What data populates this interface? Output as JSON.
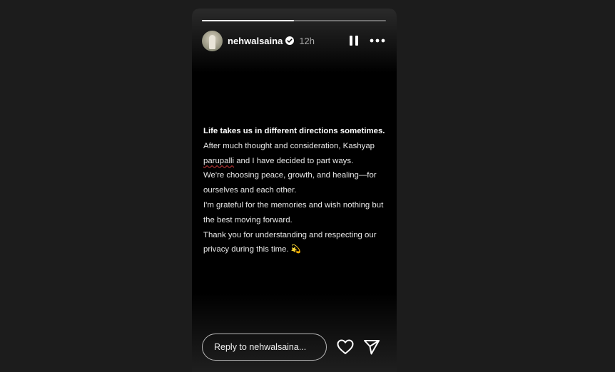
{
  "story": {
    "progress_fraction": 0.5,
    "user": {
      "username": "nehwalsaina",
      "verified": true,
      "time_ago": "12h"
    },
    "caption": {
      "lead": "Life takes us in different directions sometimes.",
      "line_a": "After much thought and consideration, Kashyap",
      "name_word": "parupalli",
      "line_b": " and I have decided to part ways.",
      "line_c": "We're choosing peace, growth, and healing—for ourselves and each other.",
      "line_d": "I'm grateful for the memories and wish nothing but the best moving forward.",
      "line_e": "Thank you for understanding and respecting our privacy during this time. 💫"
    },
    "reply": {
      "placeholder": "Reply to nehwalsaina..."
    },
    "icons": {
      "verified": "verified-badge-icon",
      "pause": "pause-icon",
      "more": "more-options-icon",
      "like": "heart-icon",
      "send": "send-icon"
    }
  },
  "colors": {
    "page_background": "#1c1c1c",
    "story_background": "#000000",
    "text": "#e8e8e8",
    "muted_text": "#a8a8a8",
    "spellcheck_underline": "#d23a3a"
  }
}
